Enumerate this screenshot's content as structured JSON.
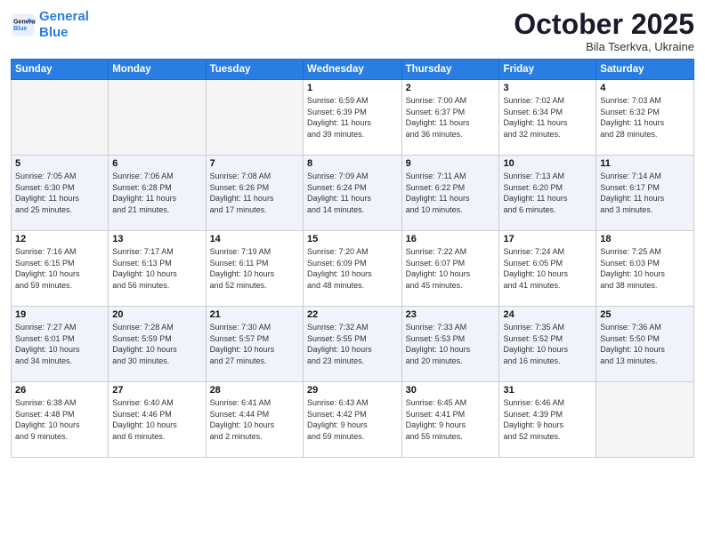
{
  "header": {
    "logo_line1": "General",
    "logo_line2": "Blue",
    "month": "October 2025",
    "location": "Bila Tserkva, Ukraine"
  },
  "weekdays": [
    "Sunday",
    "Monday",
    "Tuesday",
    "Wednesday",
    "Thursday",
    "Friday",
    "Saturday"
  ],
  "weeks": [
    [
      {
        "day": "",
        "info": ""
      },
      {
        "day": "",
        "info": ""
      },
      {
        "day": "",
        "info": ""
      },
      {
        "day": "1",
        "info": "Sunrise: 6:59 AM\nSunset: 6:39 PM\nDaylight: 11 hours\nand 39 minutes."
      },
      {
        "day": "2",
        "info": "Sunrise: 7:00 AM\nSunset: 6:37 PM\nDaylight: 11 hours\nand 36 minutes."
      },
      {
        "day": "3",
        "info": "Sunrise: 7:02 AM\nSunset: 6:34 PM\nDaylight: 11 hours\nand 32 minutes."
      },
      {
        "day": "4",
        "info": "Sunrise: 7:03 AM\nSunset: 6:32 PM\nDaylight: 11 hours\nand 28 minutes."
      }
    ],
    [
      {
        "day": "5",
        "info": "Sunrise: 7:05 AM\nSunset: 6:30 PM\nDaylight: 11 hours\nand 25 minutes."
      },
      {
        "day": "6",
        "info": "Sunrise: 7:06 AM\nSunset: 6:28 PM\nDaylight: 11 hours\nand 21 minutes."
      },
      {
        "day": "7",
        "info": "Sunrise: 7:08 AM\nSunset: 6:26 PM\nDaylight: 11 hours\nand 17 minutes."
      },
      {
        "day": "8",
        "info": "Sunrise: 7:09 AM\nSunset: 6:24 PM\nDaylight: 11 hours\nand 14 minutes."
      },
      {
        "day": "9",
        "info": "Sunrise: 7:11 AM\nSunset: 6:22 PM\nDaylight: 11 hours\nand 10 minutes."
      },
      {
        "day": "10",
        "info": "Sunrise: 7:13 AM\nSunset: 6:20 PM\nDaylight: 11 hours\nand 6 minutes."
      },
      {
        "day": "11",
        "info": "Sunrise: 7:14 AM\nSunset: 6:17 PM\nDaylight: 11 hours\nand 3 minutes."
      }
    ],
    [
      {
        "day": "12",
        "info": "Sunrise: 7:16 AM\nSunset: 6:15 PM\nDaylight: 10 hours\nand 59 minutes."
      },
      {
        "day": "13",
        "info": "Sunrise: 7:17 AM\nSunset: 6:13 PM\nDaylight: 10 hours\nand 56 minutes."
      },
      {
        "day": "14",
        "info": "Sunrise: 7:19 AM\nSunset: 6:11 PM\nDaylight: 10 hours\nand 52 minutes."
      },
      {
        "day": "15",
        "info": "Sunrise: 7:20 AM\nSunset: 6:09 PM\nDaylight: 10 hours\nand 48 minutes."
      },
      {
        "day": "16",
        "info": "Sunrise: 7:22 AM\nSunset: 6:07 PM\nDaylight: 10 hours\nand 45 minutes."
      },
      {
        "day": "17",
        "info": "Sunrise: 7:24 AM\nSunset: 6:05 PM\nDaylight: 10 hours\nand 41 minutes."
      },
      {
        "day": "18",
        "info": "Sunrise: 7:25 AM\nSunset: 6:03 PM\nDaylight: 10 hours\nand 38 minutes."
      }
    ],
    [
      {
        "day": "19",
        "info": "Sunrise: 7:27 AM\nSunset: 6:01 PM\nDaylight: 10 hours\nand 34 minutes."
      },
      {
        "day": "20",
        "info": "Sunrise: 7:28 AM\nSunset: 5:59 PM\nDaylight: 10 hours\nand 30 minutes."
      },
      {
        "day": "21",
        "info": "Sunrise: 7:30 AM\nSunset: 5:57 PM\nDaylight: 10 hours\nand 27 minutes."
      },
      {
        "day": "22",
        "info": "Sunrise: 7:32 AM\nSunset: 5:55 PM\nDaylight: 10 hours\nand 23 minutes."
      },
      {
        "day": "23",
        "info": "Sunrise: 7:33 AM\nSunset: 5:53 PM\nDaylight: 10 hours\nand 20 minutes."
      },
      {
        "day": "24",
        "info": "Sunrise: 7:35 AM\nSunset: 5:52 PM\nDaylight: 10 hours\nand 16 minutes."
      },
      {
        "day": "25",
        "info": "Sunrise: 7:36 AM\nSunset: 5:50 PM\nDaylight: 10 hours\nand 13 minutes."
      }
    ],
    [
      {
        "day": "26",
        "info": "Sunrise: 6:38 AM\nSunset: 4:48 PM\nDaylight: 10 hours\nand 9 minutes."
      },
      {
        "day": "27",
        "info": "Sunrise: 6:40 AM\nSunset: 4:46 PM\nDaylight: 10 hours\nand 6 minutes."
      },
      {
        "day": "28",
        "info": "Sunrise: 6:41 AM\nSunset: 4:44 PM\nDaylight: 10 hours\nand 2 minutes."
      },
      {
        "day": "29",
        "info": "Sunrise: 6:43 AM\nSunset: 4:42 PM\nDaylight: 9 hours\nand 59 minutes."
      },
      {
        "day": "30",
        "info": "Sunrise: 6:45 AM\nSunset: 4:41 PM\nDaylight: 9 hours\nand 55 minutes."
      },
      {
        "day": "31",
        "info": "Sunrise: 6:46 AM\nSunset: 4:39 PM\nDaylight: 9 hours\nand 52 minutes."
      },
      {
        "day": "",
        "info": ""
      }
    ]
  ]
}
